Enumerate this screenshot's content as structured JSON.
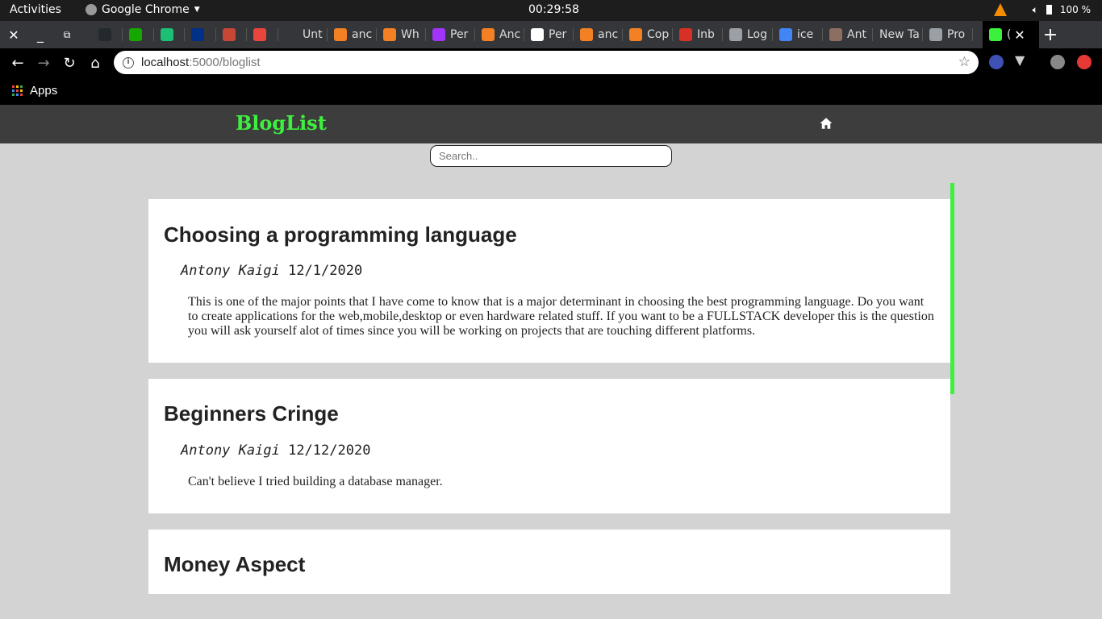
{
  "system_bar": {
    "activities": "Activities",
    "app_name": "Google Chrome",
    "clock": "00:29:58",
    "battery": "100 %"
  },
  "tabs": [
    {
      "label": "",
      "icon": "github-icon",
      "color": "#24292e"
    },
    {
      "label": "",
      "icon": "upwork-icon",
      "color": "#14a800"
    },
    {
      "label": "",
      "icon": "fiverr-icon",
      "color": "#1dbf73"
    },
    {
      "label": "",
      "icon": "paypal-icon",
      "color": "#003087"
    },
    {
      "label": "",
      "icon": "oracle-icon",
      "color": "#c74634"
    },
    {
      "label": "",
      "icon": "app-icon",
      "color": "#e8453c"
    },
    {
      "label": "Unt",
      "icon": "blank-icon",
      "color": "#35363a"
    },
    {
      "label": "anc",
      "icon": "stackoverflow-icon",
      "color": "#f48024"
    },
    {
      "label": "Wh",
      "icon": "stackoverflow-icon",
      "color": "#f48024"
    },
    {
      "label": "Per",
      "icon": "messenger-icon",
      "color": "#a334fa"
    },
    {
      "label": "Anc",
      "icon": "stackoverflow-icon",
      "color": "#f48024"
    },
    {
      "label": "Per",
      "icon": "xml-icon",
      "color": "#ffffff"
    },
    {
      "label": "anc",
      "icon": "stackoverflow-icon",
      "color": "#f48024"
    },
    {
      "label": "Cop",
      "icon": "stackoverflow-icon",
      "color": "#f48024"
    },
    {
      "label": "Inb",
      "icon": "gmail-icon",
      "color": "#d93025"
    },
    {
      "label": "Log",
      "icon": "globe-icon",
      "color": "#9aa0a6"
    },
    {
      "label": "ice",
      "icon": "google-icon",
      "color": "#4285f4"
    },
    {
      "label": "Ant",
      "icon": "avatar-icon",
      "color": "#8d6e63"
    },
    {
      "label": "New Ta",
      "icon": "none",
      "color": "#35363a"
    },
    {
      "label": "Pro",
      "icon": "globe-icon",
      "color": "#9aa0a6"
    },
    {
      "label": "(",
      "icon": "app-icon",
      "color": "#3ef03e",
      "active": true
    }
  ],
  "omnibox": {
    "host": "localhost",
    "path": ":5000/bloglist"
  },
  "bookmarks": {
    "apps_label": "Apps"
  },
  "page": {
    "brand": "BlogList",
    "search_placeholder": "Search..",
    "accent_color": "#3ef03e",
    "posts": [
      {
        "title": "Choosing a programming language",
        "author": "Antony Kaigi",
        "date": "12/1/2020",
        "body": "This is one of the major points that I have come to know that is a major determinant in choosing the best programming language. Do you want to create applications for the web,mobile,desktop or even hardware related stuff. If you want to be a FULLSTACK developer this is the question you will ask yourself alot of times since you will be working on projects that are touching different platforms."
      },
      {
        "title": "Beginners Cringe",
        "author": "Antony Kaigi",
        "date": "12/12/2020",
        "body": "Can't believe I tried building a database manager."
      },
      {
        "title": "Money Aspect"
      }
    ]
  }
}
